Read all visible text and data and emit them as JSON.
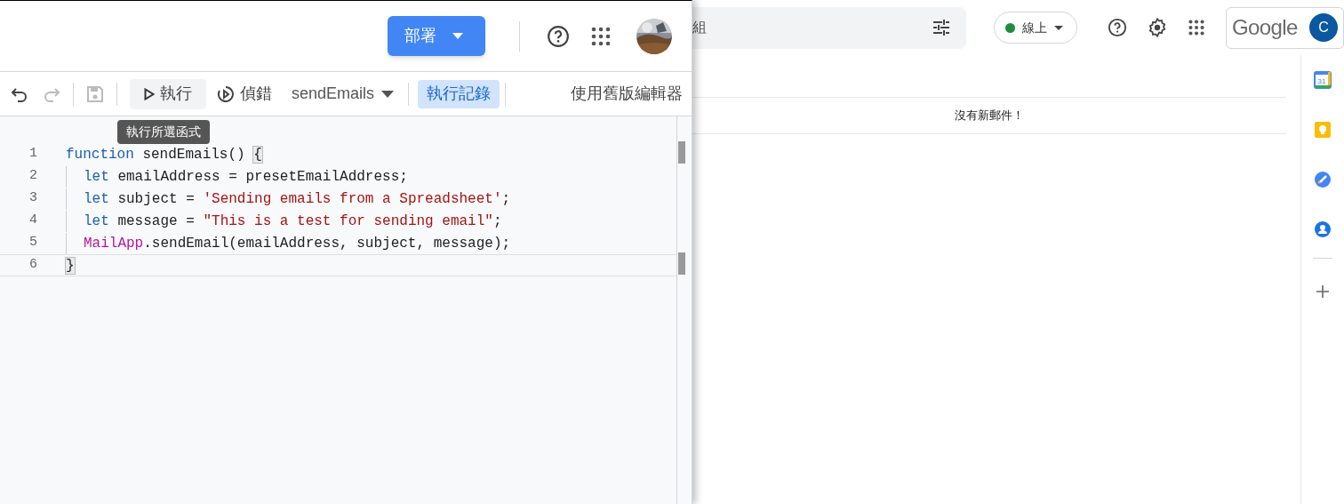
{
  "editor_header": {
    "deploy_button": "部署"
  },
  "toolbar": {
    "undo": {
      "disabled": false
    },
    "redo": {
      "disabled": true
    },
    "save": {
      "disabled": true
    },
    "run_button": {
      "label": "執行",
      "hovered": true
    },
    "debug_button": {
      "label": "偵錯"
    },
    "function_select": {
      "value": "sendEmails"
    },
    "log_toggle": {
      "label": "執行記錄",
      "selected": true
    },
    "legacy_link": "使用舊版編輯器"
  },
  "tooltip": "執行所選函式",
  "code_lines": [
    {
      "number": "1",
      "current": false,
      "indent": false,
      "tokens": [
        {
          "kind": "keyword",
          "text": "function"
        },
        {
          "kind": "plain",
          "text": " sendEmails() "
        },
        {
          "kind": "bracket",
          "text": "{"
        }
      ]
    },
    {
      "number": "2",
      "current": false,
      "indent": true,
      "tokens": [
        {
          "kind": "keyword",
          "text": "let"
        },
        {
          "kind": "plain",
          "text": " emailAddress = presetEmailAddress;"
        }
      ]
    },
    {
      "number": "3",
      "current": false,
      "indent": true,
      "tokens": [
        {
          "kind": "keyword",
          "text": "let"
        },
        {
          "kind": "plain",
          "text": " subject = "
        },
        {
          "kind": "string",
          "text": "'Sending emails from a Spreadsheet'"
        },
        {
          "kind": "plain",
          "text": ";"
        }
      ]
    },
    {
      "number": "4",
      "current": false,
      "indent": true,
      "tokens": [
        {
          "kind": "keyword",
          "text": "let"
        },
        {
          "kind": "plain",
          "text": " message = "
        },
        {
          "kind": "string",
          "text": "\"This is a test for sending email\""
        },
        {
          "kind": "plain",
          "text": ";"
        }
      ]
    },
    {
      "number": "5",
      "current": false,
      "indent": true,
      "tokens": [
        {
          "kind": "class",
          "text": "MailApp"
        },
        {
          "kind": "plain",
          "text": ".sendEmail(emailAddress, subject, message);"
        }
      ]
    },
    {
      "number": "6",
      "current": true,
      "indent": false,
      "tokens": [
        {
          "kind": "bracket",
          "text": "}"
        }
      ]
    }
  ],
  "gmail": {
    "search": {
      "placeholder": "組"
    },
    "status": {
      "label": "線上",
      "color": "#1e8e3e"
    },
    "account": {
      "logo": "Google",
      "initial": "C"
    },
    "empty_message": "沒有新郵件！"
  },
  "side_apps": [
    {
      "kind": "calendar",
      "text": "31"
    },
    {
      "kind": "keep"
    },
    {
      "kind": "tasks"
    },
    {
      "kind": "contacts"
    }
  ]
}
